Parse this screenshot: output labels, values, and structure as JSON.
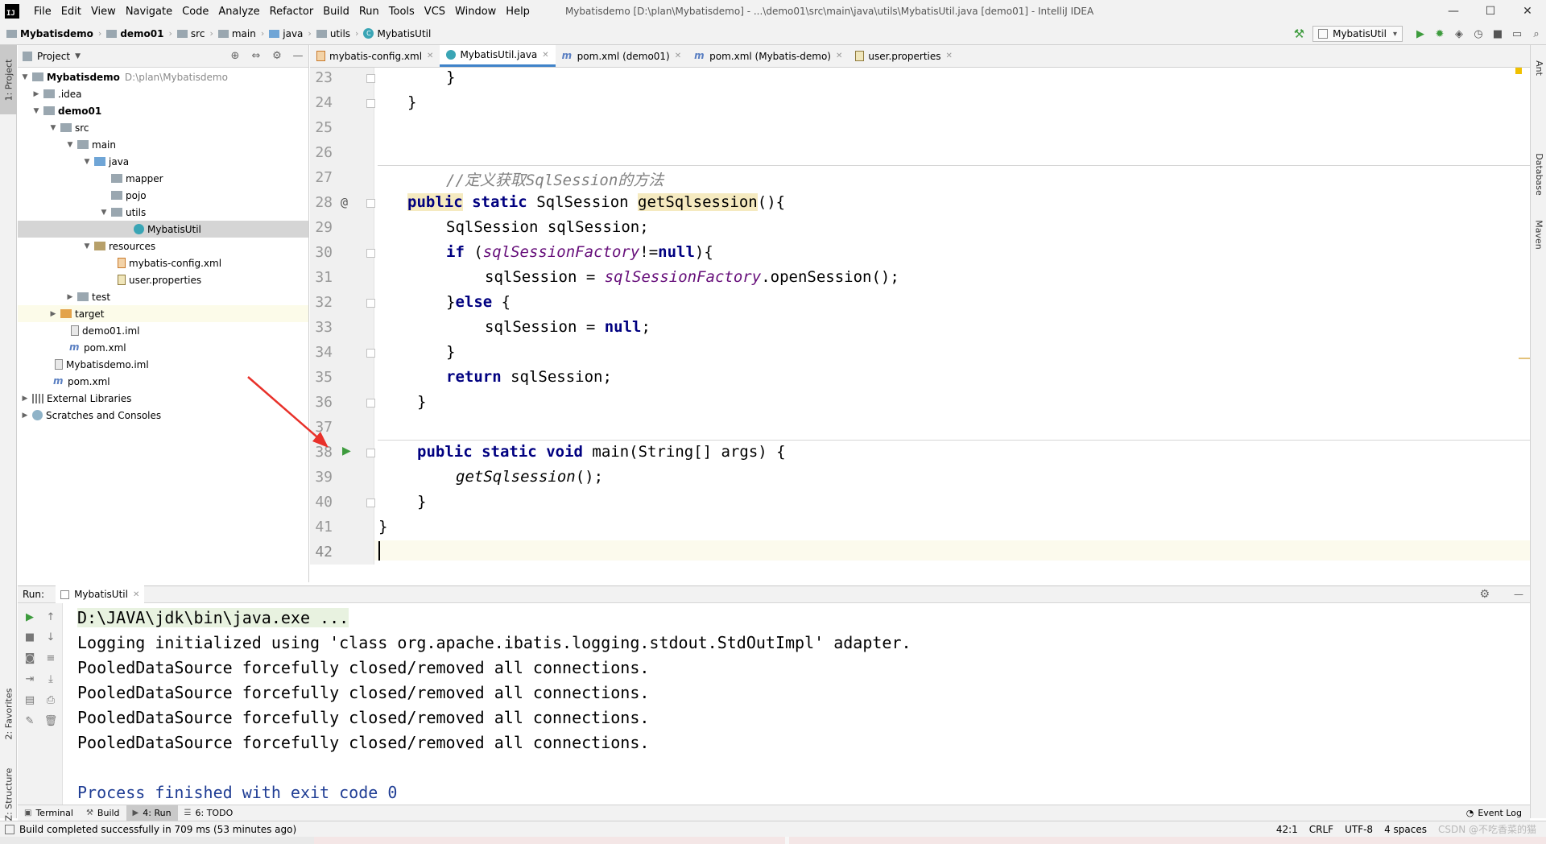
{
  "menubar": {
    "logo": "IJ",
    "items": [
      "File",
      "Edit",
      "View",
      "Navigate",
      "Code",
      "Analyze",
      "Refactor",
      "Build",
      "Run",
      "Tools",
      "VCS",
      "Window",
      "Help"
    ],
    "title": "Mybatisdemo [D:\\plan\\Mybatisdemo] - ...\\demo01\\src\\main\\java\\utils\\MybatisUtil.java [demo01] - IntelliJ IDEA",
    "window_controls": [
      "—",
      "☐",
      "✕"
    ]
  },
  "breadcrumb": [
    "Mybatisdemo",
    "demo01",
    "src",
    "main",
    "java",
    "utils",
    "MybatisUtil"
  ],
  "toolbar": {
    "run_config": "MybatisUtil",
    "icons": [
      "hammer-icon",
      "run-icon",
      "debug-icon",
      "coverage-icon",
      "profile-icon",
      "stop-icon",
      "project-structure-icon",
      "search-icon"
    ]
  },
  "left_tool_tabs": {
    "project": "1: Project",
    "favorites": "2: Favorites",
    "structure": "Z: Structure"
  },
  "right_tool_tabs": {
    "ant": "Ant",
    "database": "Database",
    "maven": "Maven"
  },
  "project_panel": {
    "title": "Project",
    "tree": {
      "root_name": "Mybatisdemo",
      "root_path": "D:\\plan\\Mybatisdemo",
      "idea": ".idea",
      "demo01": "demo01",
      "src": "src",
      "main": "main",
      "java": "java",
      "mapper": "mapper",
      "pojo": "pojo",
      "utils": "utils",
      "mybatisutil": "MybatisUtil",
      "resources": "resources",
      "mybatis_config": "mybatis-config.xml",
      "user_properties": "user.properties",
      "test": "test",
      "target": "target",
      "demo01_iml": "demo01.iml",
      "demo01_pom": "pom.xml",
      "mybatisdemo_iml": "Mybatisdemo.iml",
      "root_pom": "pom.xml",
      "external_libraries": "External Libraries",
      "scratches": "Scratches and Consoles"
    }
  },
  "editor_tabs": [
    {
      "label": "mybatis-config.xml",
      "icon": "xml-icon"
    },
    {
      "label": "MybatisUtil.java",
      "icon": "class-icon",
      "active": true
    },
    {
      "label": "pom.xml (demo01)",
      "icon": "maven-icon"
    },
    {
      "label": "pom.xml (Mybatis-demo)",
      "icon": "maven-icon"
    },
    {
      "label": "user.properties",
      "icon": "properties-icon"
    }
  ],
  "editor": {
    "line_numbers": [
      "23",
      "24",
      "25",
      "26",
      "27",
      "28",
      "29",
      "30",
      "31",
      "32",
      "33",
      "34",
      "35",
      "36",
      "37",
      "38",
      "39",
      "40",
      "41",
      "42"
    ],
    "comment": "//定义获取SqlSession的方法",
    "gutter_at": "@",
    "gutter_run": "▶",
    "tok": {
      "brace_close": "}",
      "brace_open": "{",
      "public": "public",
      "static": "static",
      "void": "void",
      "if": "if",
      "null": "null",
      "else": "else",
      "return": "return",
      "sqlsession_type": "SqlSession",
      "getsqlsession": "getSqlsession",
      "parens_open": "(){",
      "line29": "SqlSession sqlSession;",
      "paren": "(",
      "factory": "sqlSessionFactory",
      "neq": "!=",
      "close_paren_brace": "){",
      "line31_a": "sqlSession = ",
      "line31_b": ".openSession();",
      "line32_b": " {",
      "semicolon": ";",
      "line35_b": " sqlSession;",
      "main_sig": "main(String[] args) {",
      "main_call": "getSqlsession",
      "call_end": "();"
    }
  },
  "run_panel": {
    "label": "Run:",
    "tab": "MybatisUtil",
    "console": [
      "D:\\JAVA\\jdk\\bin\\java.exe ...",
      "Logging initialized using 'class org.apache.ibatis.logging.stdout.StdOutImpl' adapter.",
      "PooledDataSource forcefully closed/removed all connections.",
      "PooledDataSource forcefully closed/removed all connections.",
      "PooledDataSource forcefully closed/removed all connections.",
      "PooledDataSource forcefully closed/removed all connections.",
      "",
      "Process finished with exit code 0"
    ]
  },
  "bottom_tabs": {
    "terminal": "Terminal",
    "build": "Build",
    "run": "4: Run",
    "todo": "6: TODO",
    "event_log": "Event Log"
  },
  "statusbar": {
    "message": "Build completed successfully in 709 ms (53 minutes ago)",
    "position": "42:1",
    "line_sep": "CRLF",
    "encoding": "UTF-8",
    "indent": "4 spaces",
    "watermark": "CSDN @不吃香菜的猫"
  },
  "colors": {
    "keyword": "#000080",
    "comment": "#808080",
    "field": "#660e7a",
    "run_green": "#3d9b3d",
    "process_finished": "#1f3d94",
    "active_tab_underline": "#4083c9"
  }
}
